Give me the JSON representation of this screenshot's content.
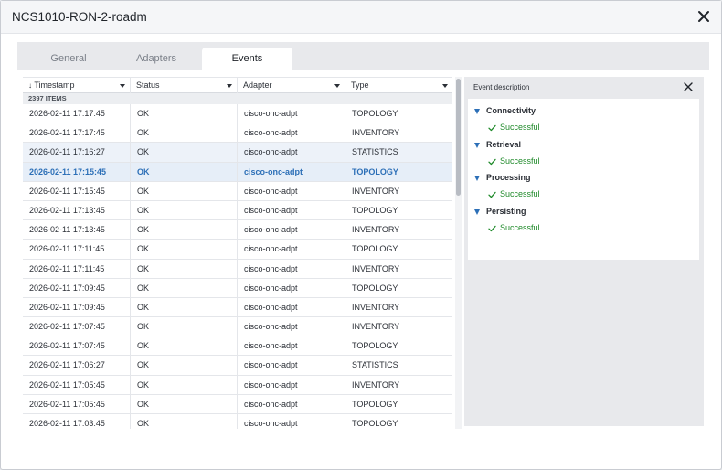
{
  "window": {
    "title": "NCS1010-RON-2-roadm"
  },
  "tabs": [
    {
      "label": "General"
    },
    {
      "label": "Adapters"
    },
    {
      "label": "Events"
    }
  ],
  "table": {
    "columns": [
      "Timestamp",
      "Status",
      "Adapter",
      "Type"
    ],
    "sort_column": "Timestamp",
    "item_count": "2397 ITEMS",
    "rows": [
      [
        "2026-02-11 17:17:45",
        "OK",
        "cisco-onc-adpt",
        "TOPOLOGY"
      ],
      [
        "2026-02-11 17:17:45",
        "OK",
        "cisco-onc-adpt",
        "INVENTORY"
      ],
      [
        "2026-02-11 17:16:27",
        "OK",
        "cisco-onc-adpt",
        "STATISTICS"
      ],
      [
        "2026-02-11 17:15:45",
        "OK",
        "cisco-onc-adpt",
        "TOPOLOGY"
      ],
      [
        "2026-02-11 17:15:45",
        "OK",
        "cisco-onc-adpt",
        "INVENTORY"
      ],
      [
        "2026-02-11 17:13:45",
        "OK",
        "cisco-onc-adpt",
        "TOPOLOGY"
      ],
      [
        "2026-02-11 17:13:45",
        "OK",
        "cisco-onc-adpt",
        "INVENTORY"
      ],
      [
        "2026-02-11 17:11:45",
        "OK",
        "cisco-onc-adpt",
        "TOPOLOGY"
      ],
      [
        "2026-02-11 17:11:45",
        "OK",
        "cisco-onc-adpt",
        "INVENTORY"
      ],
      [
        "2026-02-11 17:09:45",
        "OK",
        "cisco-onc-adpt",
        "TOPOLOGY"
      ],
      [
        "2026-02-11 17:09:45",
        "OK",
        "cisco-onc-adpt",
        "INVENTORY"
      ],
      [
        "2026-02-11 17:07:45",
        "OK",
        "cisco-onc-adpt",
        "INVENTORY"
      ],
      [
        "2026-02-11 17:07:45",
        "OK",
        "cisco-onc-adpt",
        "TOPOLOGY"
      ],
      [
        "2026-02-11 17:06:27",
        "OK",
        "cisco-onc-adpt",
        "STATISTICS"
      ],
      [
        "2026-02-11 17:05:45",
        "OK",
        "cisco-onc-adpt",
        "INVENTORY"
      ],
      [
        "2026-02-11 17:05:45",
        "OK",
        "cisco-onc-adpt",
        "TOPOLOGY"
      ],
      [
        "2026-02-11 17:03:45",
        "OK",
        "cisco-onc-adpt",
        "TOPOLOGY"
      ]
    ],
    "selected_row": 3,
    "hovered_row": 2
  },
  "event_description": {
    "title": "Event description",
    "groups": [
      {
        "name": "Connectivity",
        "status": "Successful"
      },
      {
        "name": "Retrieval",
        "status": "Successful"
      },
      {
        "name": "Processing",
        "status": "Successful"
      },
      {
        "name": "Persisting",
        "status": "Successful"
      }
    ]
  },
  "colors": {
    "accent": "#2c6fb7",
    "success": "#1f8a2a",
    "selected_row_bg": "#e6eef8"
  }
}
